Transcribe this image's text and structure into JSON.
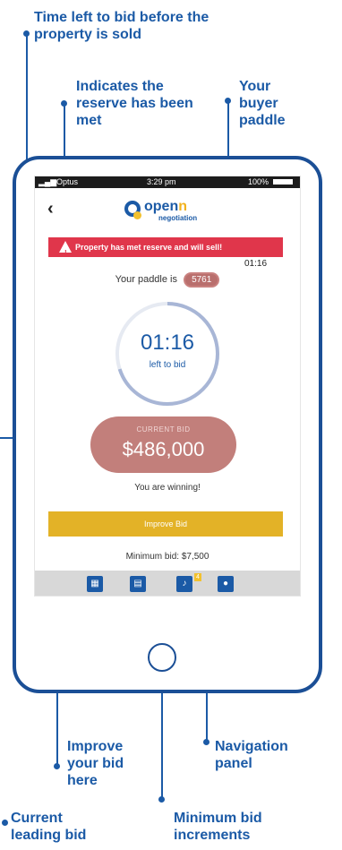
{
  "annotations": {
    "time_left": "Time left to bid before the property is sold",
    "reserve": "Indicates the reserve has been met",
    "paddle": "Your buyer paddle",
    "improve": "Improve your bid here",
    "navigation": "Navigation panel",
    "current_bid": "Current leading bid",
    "min_increments": "Minimum bid increments"
  },
  "status_bar": {
    "carrier": "Optus",
    "time": "3:29 pm",
    "battery": "100%"
  },
  "header": {
    "back_glyph": "‹",
    "logo_prefix": "open",
    "logo_suffix": "n",
    "logo_sub": "negotiation"
  },
  "banner": {
    "text": "Property has met reserve and will sell!",
    "timer": "01:16"
  },
  "paddle": {
    "label": "Your paddle is",
    "number": "5761"
  },
  "countdown": {
    "time": "01:16",
    "label": "left to bid",
    "progress_fraction": 0.7
  },
  "current_bid": {
    "label": "CURRENT BID",
    "amount": "$486,000"
  },
  "status_message": "You are winning!",
  "improve_button": "Improve Bid",
  "minimum_bid": "Minimum bid: $7,500",
  "nav": {
    "notification_count": "4",
    "icons": [
      "grid-icon",
      "listing-icon",
      "bell-icon",
      "profile-icon"
    ]
  },
  "colors": {
    "annotation": "#1b5aa6",
    "banner": "#e0364b",
    "bid_pill": "#c27f7b",
    "improve_button": "#e3b227",
    "nav_icon": "#1b5aa6"
  }
}
